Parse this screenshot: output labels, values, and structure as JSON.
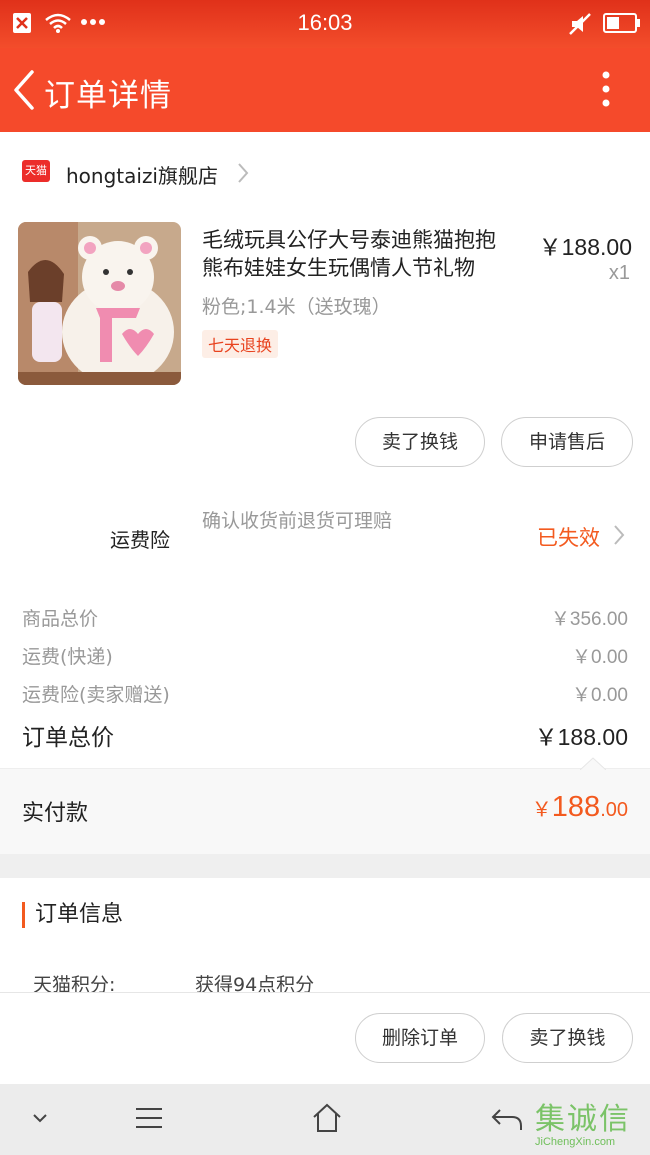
{
  "status_bar": {
    "time": "16:03"
  },
  "nav": {
    "title": "订单详情"
  },
  "shop": {
    "name": "hongtaizi旗舰店",
    "badge": "天猫"
  },
  "product": {
    "title": "毛绒玩具公仔大号泰迪熊猫抱抱熊布娃娃女生玩偶情人节礼物",
    "sku": "粉色;1.4米（送玫瑰）",
    "badge": "七天退换",
    "price": "￥188.00",
    "qty": "x1"
  },
  "actions": {
    "sell_label": "卖了换钱",
    "after_sale_label": "申请售后"
  },
  "insurance": {
    "label": "运费险",
    "desc": "确认收货前退货可理赔",
    "status": "已失效"
  },
  "summary": {
    "goods_label": "商品总价",
    "goods_value": "￥356.00",
    "shipping_label": "运费(快递)",
    "shipping_value": "￥0.00",
    "ins_label": "运费险(卖家赠送)",
    "ins_value": "￥0.00",
    "total_label": "订单总价",
    "total_value": "￥188.00"
  },
  "paid": {
    "label": "实付款",
    "currency": "￥",
    "integer": "188",
    "decimal": ".00"
  },
  "order_info": {
    "title": "订单信息",
    "points_key": "天猫积分:",
    "points_value": "获得94点积分"
  },
  "bottom": {
    "delete_label": "删除订单",
    "sell_label": "卖了换钱"
  },
  "watermark": {
    "main": "集诚信",
    "sub": "JiChengXin.com"
  },
  "colors": {
    "brand": "#f54a2b",
    "accent": "#f35a1f",
    "muted": "#999999"
  },
  "icons": [
    "close-box-icon",
    "wifi-icon",
    "more-dots-icon",
    "mute-icon",
    "battery-icon",
    "back-arrow-icon",
    "more-vertical-icon",
    "chevron-right-icon",
    "chevron-down-icon",
    "menu-icon",
    "home-icon",
    "back-icon"
  ]
}
